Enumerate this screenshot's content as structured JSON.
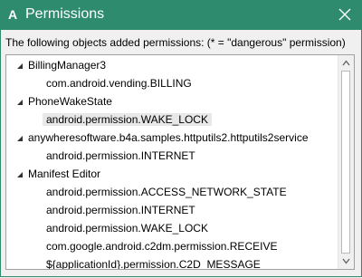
{
  "window": {
    "title": "Permissions",
    "app_icon": "A",
    "accent": "#2e8b6e"
  },
  "info_text": "The following objects added permissions: (* = \"dangerous\" permission)",
  "tree": {
    "groups": [
      {
        "name": "BillingManager3",
        "expanded": true,
        "items": [
          "com.android.vending.BILLING"
        ]
      },
      {
        "name": "PhoneWakeState",
        "expanded": true,
        "items": [
          "android.permission.WAKE_LOCK"
        ]
      },
      {
        "name": "anywheresoftware.b4a.samples.httputils2.httputils2service",
        "expanded": true,
        "items": [
          "android.permission.INTERNET"
        ]
      },
      {
        "name": "Manifest Editor",
        "expanded": true,
        "items": [
          "android.permission.ACCESS_NETWORK_STATE",
          "android.permission.INTERNET",
          "android.permission.WAKE_LOCK",
          "com.google.android.c2dm.permission.RECEIVE",
          "${applicationId}.permission.C2D_MESSAGE"
        ]
      }
    ],
    "selected_item": "android.permission.WAKE_LOCK"
  }
}
